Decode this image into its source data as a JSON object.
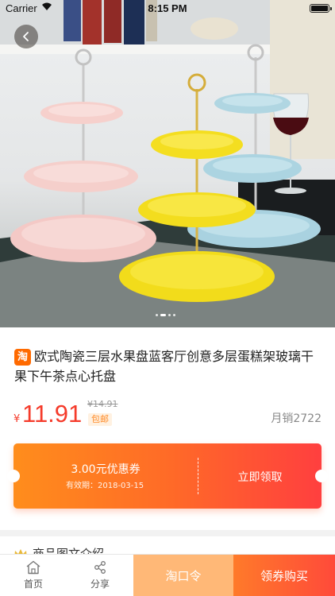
{
  "status_bar": {
    "carrier": "Carrier",
    "time": "8:15 PM"
  },
  "hero": {
    "slide_count": 4,
    "active_slide": 2
  },
  "product": {
    "platform_badge": "淘",
    "title": "欧式陶瓷三层水果盘蓝客厅创意多层蛋糕架玻璃干果下午茶点心托盘",
    "currency_symbol": "¥",
    "price": "11.91",
    "original_price": "¥14.91",
    "shipping_tag": "包邮",
    "monthly_sales": "月销2722"
  },
  "coupon": {
    "amount": "3.00元优惠券",
    "validity": "有效期：2018-03-15",
    "claim_label": "立即领取"
  },
  "section": {
    "title": "商品图文介绍"
  },
  "bottom_bar": {
    "home_label": "首页",
    "share_label": "分享",
    "taokouling_label": "淘口令",
    "buy_label": "领券购买"
  },
  "colors": {
    "accent_red": "#f53b2b",
    "accent_orange": "#ff6a00",
    "coupon_light": "#ffb877"
  }
}
